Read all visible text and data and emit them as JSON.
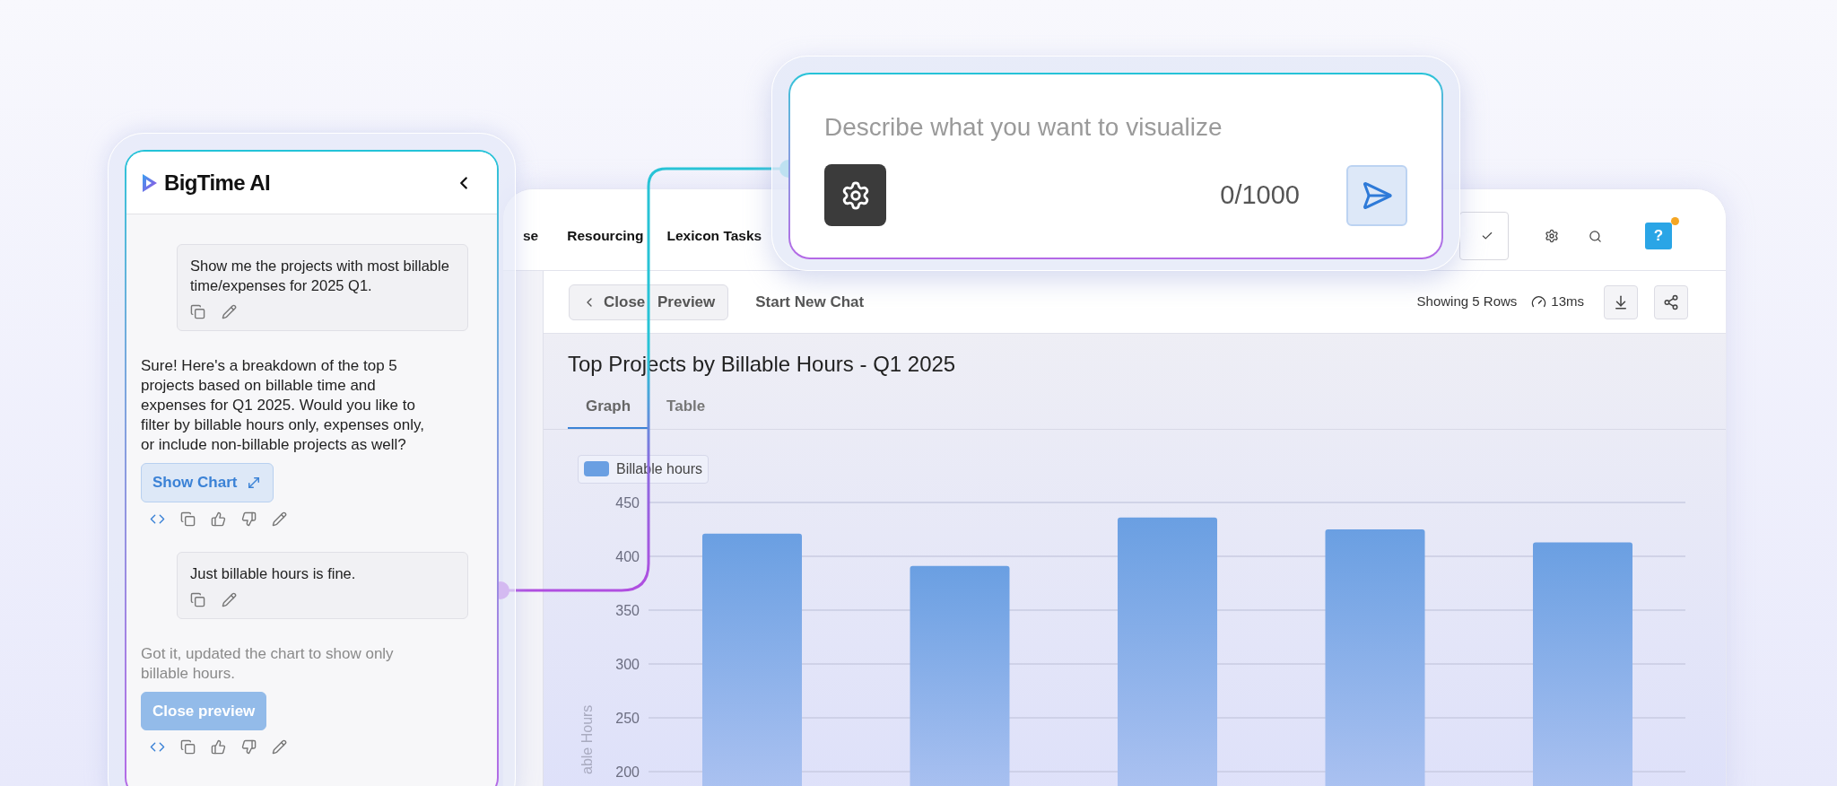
{
  "app": {
    "nav": [
      {
        "label": "se"
      },
      {
        "label": "Resourcing"
      },
      {
        "label": "Lexicon Tasks"
      }
    ],
    "help": {
      "label": "?",
      "notification": true
    },
    "toolbar": {
      "close_preview": "Close Preview",
      "new_chat": "Start New Chat",
      "rows": "Showing 5 Rows",
      "time": "13ms"
    },
    "report": {
      "title": "Top Projects by Billable Hours - Q1 2025",
      "tabs": [
        {
          "label": "Graph",
          "selected": true
        },
        {
          "label": "Table",
          "selected": false
        }
      ],
      "chart_data": {
        "type": "bar",
        "grid": true,
        "ylabel": "able Hours",
        "ylim": [
          200,
          450
        ],
        "yticks": [
          200,
          250,
          300,
          350,
          400,
          450
        ],
        "series": [
          {
            "name": "Billable hours",
            "color": "#6a9fe2",
            "values": [
              421,
              391,
              436,
              425,
              413
            ]
          }
        ]
      }
    }
  },
  "chat": {
    "title": "BigTime AI",
    "messages": [
      {
        "kind": "user",
        "text": "Show me the projects with most billable time/expenses for 2025 Q1."
      },
      {
        "kind": "assistant",
        "text": "Sure! Here's a breakdown of the top 5 projects based on billable time and expenses for Q1 2025. Would you like to filter by billable hours only, expenses only, or include non-billable projects as well?",
        "muted": false,
        "button": {
          "label": "Show Chart",
          "kind": "outline"
        }
      },
      {
        "kind": "user",
        "text": "Just billable hours is fine."
      },
      {
        "kind": "assistant",
        "text": "Got it, updated the chart to show only billable hours.",
        "muted": true,
        "button": {
          "label": "Close preview",
          "kind": "filled"
        }
      }
    ]
  },
  "prompt": {
    "placeholder": "Describe what you want to visualize",
    "counter": "0/1000"
  }
}
